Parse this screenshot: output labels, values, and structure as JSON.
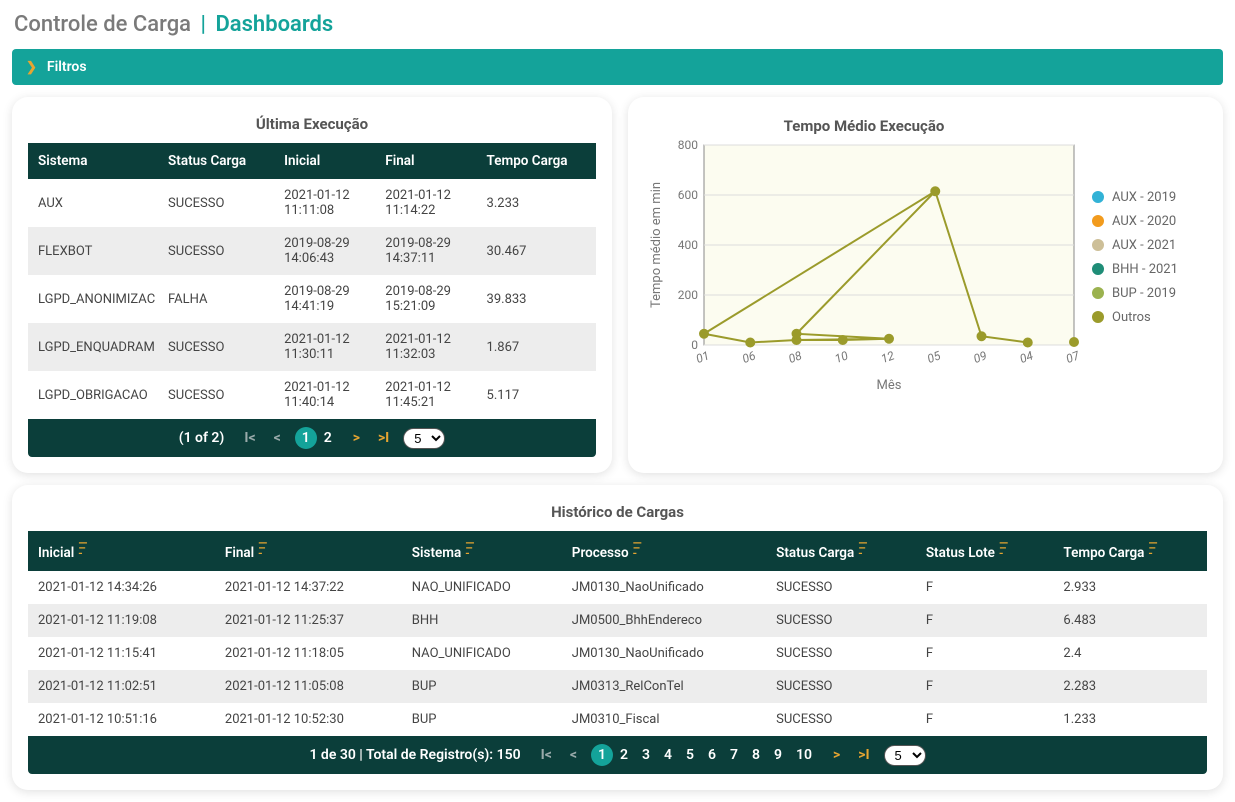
{
  "header": {
    "app": "Controle de Carga",
    "separator": "|",
    "page": "Dashboards"
  },
  "filters": {
    "label": "Filtros"
  },
  "ultima_execucao": {
    "title": "Última Execução",
    "columns": [
      "Sistema",
      "Status Carga",
      "Inicial",
      "Final",
      "Tempo Carga"
    ],
    "rows": [
      {
        "sistema": "AUX",
        "status": "SUCESSO",
        "inicial": "2021-01-12 11:11:08",
        "final": "2021-01-12 11:14:22",
        "tempo": "3.233"
      },
      {
        "sistema": "FLEXBOT",
        "status": "SUCESSO",
        "inicial": "2019-08-29 14:06:43",
        "final": "2019-08-29 14:37:11",
        "tempo": "30.467"
      },
      {
        "sistema": "LGPD_ANONIMIZAC",
        "status": "FALHA",
        "inicial": "2019-08-29 14:41:19",
        "final": "2019-08-29 15:21:09",
        "tempo": "39.833"
      },
      {
        "sistema": "LGPD_ENQUADRAM",
        "status": "SUCESSO",
        "inicial": "2021-01-12 11:30:11",
        "final": "2021-01-12 11:32:03",
        "tempo": "1.867"
      },
      {
        "sistema": "LGPD_OBRIGACAO",
        "status": "SUCESSO",
        "inicial": "2021-01-12 11:40:14",
        "final": "2021-01-12 11:45:21",
        "tempo": "5.117"
      }
    ],
    "paginator": {
      "info": "(1 of 2)",
      "pages": [
        "1",
        "2"
      ],
      "current": "1",
      "pagesize": "5"
    }
  },
  "chart_data": {
    "type": "line",
    "title": "Tempo Médio Execução",
    "xlabel": "Mês",
    "ylabel": "Tempo médio em min",
    "ylim": [
      0,
      800
    ],
    "yticks": [
      0,
      200,
      400,
      600,
      800
    ],
    "categories": [
      "01",
      "06",
      "08",
      "10",
      "12",
      "05",
      "09",
      "04",
      "07"
    ],
    "series": [
      {
        "name": "AUX - 2019",
        "color": "#32b2d6",
        "values": [
          null,
          null,
          null,
          null,
          null,
          null,
          null,
          null,
          null
        ]
      },
      {
        "name": "AUX - 2020",
        "color": "#f29b1d",
        "values": [
          null,
          null,
          null,
          null,
          null,
          null,
          null,
          null,
          null
        ]
      },
      {
        "name": "AUX - 2021",
        "color": "#cdbf98",
        "values": [
          null,
          null,
          null,
          null,
          null,
          null,
          null,
          null,
          null
        ]
      },
      {
        "name": "BHH - 2021",
        "color": "#1f8d77",
        "values": [
          null,
          null,
          null,
          null,
          null,
          null,
          null,
          null,
          null
        ]
      },
      {
        "name": "BUP - 2019",
        "color": "#9bb24f",
        "values": [
          null,
          null,
          null,
          null,
          null,
          null,
          null,
          null,
          null
        ]
      },
      {
        "name": "Outros",
        "color": "#9b9b2b",
        "points": [
          {
            "x": "01",
            "y": 45
          },
          {
            "x": "06",
            "y": 10
          },
          {
            "x": "08",
            "y": 20
          },
          {
            "x": "08",
            "y": 45
          },
          {
            "x": "10",
            "y": 20
          },
          {
            "x": "12",
            "y": 25
          },
          {
            "x": "05",
            "y": 615
          },
          {
            "x": "09",
            "y": 35
          },
          {
            "x": "04",
            "y": 10
          },
          {
            "x": "07",
            "y": 12
          }
        ]
      }
    ],
    "legend": [
      "AUX - 2019",
      "AUX - 2020",
      "AUX - 2021",
      "BHH - 2021",
      "BUP - 2019",
      "Outros"
    ],
    "legend_colors": [
      "#32b2d6",
      "#f29b1d",
      "#cdbf98",
      "#1f8d77",
      "#9bb24f",
      "#9b9b2b"
    ]
  },
  "historico": {
    "title": "Histórico de Cargas",
    "columns": [
      "Inicial",
      "Final",
      "Sistema",
      "Processo",
      "Status Carga",
      "Status Lote",
      "Tempo Carga"
    ],
    "rows": [
      {
        "inicial": "2021-01-12 14:34:26",
        "final": "2021-01-12 14:37:22",
        "sistema": "NAO_UNIFICADO",
        "processo": "JM0130_NaoUnificado",
        "status": "SUCESSO",
        "lote": "F",
        "tempo": "2.933"
      },
      {
        "inicial": "2021-01-12 11:19:08",
        "final": "2021-01-12 11:25:37",
        "sistema": "BHH",
        "processo": "JM0500_BhhEndereco",
        "status": "SUCESSO",
        "lote": "F",
        "tempo": "6.483"
      },
      {
        "inicial": "2021-01-12 11:15:41",
        "final": "2021-01-12 11:18:05",
        "sistema": "NAO_UNIFICADO",
        "processo": "JM0130_NaoUnificado",
        "status": "SUCESSO",
        "lote": "F",
        "tempo": "2.4"
      },
      {
        "inicial": "2021-01-12 11:02:51",
        "final": "2021-01-12 11:05:08",
        "sistema": "BUP",
        "processo": "JM0313_RelConTel",
        "status": "SUCESSO",
        "lote": "F",
        "tempo": "2.283"
      },
      {
        "inicial": "2021-01-12 10:51:16",
        "final": "2021-01-12 10:52:30",
        "sistema": "BUP",
        "processo": "JM0310_Fiscal",
        "status": "SUCESSO",
        "lote": "F",
        "tempo": "1.233"
      }
    ],
    "paginator": {
      "info": "1 de 30 | Total de Registro(s): 150",
      "pages": [
        "1",
        "2",
        "3",
        "4",
        "5",
        "6",
        "7",
        "8",
        "9",
        "10"
      ],
      "current": "1",
      "pagesize": "5"
    }
  }
}
